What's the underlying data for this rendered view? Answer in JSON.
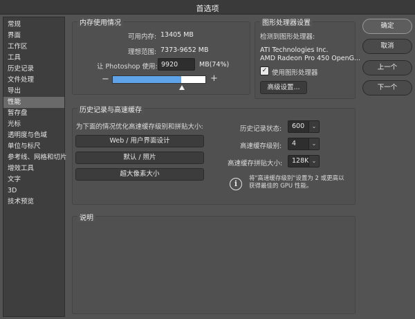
{
  "window": {
    "title": "首选项"
  },
  "sidebar": {
    "items": [
      {
        "label": "常规"
      },
      {
        "label": "界面"
      },
      {
        "label": "工作区"
      },
      {
        "label": "工具"
      },
      {
        "label": "历史记录"
      },
      {
        "label": "文件处理"
      },
      {
        "label": "导出"
      },
      {
        "label": "性能",
        "active": true
      },
      {
        "label": "暂存盘"
      },
      {
        "label": "光标"
      },
      {
        "label": "透明度与色域"
      },
      {
        "label": "单位与标尺"
      },
      {
        "label": "参考线、网格和切片"
      },
      {
        "label": "增效工具"
      },
      {
        "label": "文字"
      },
      {
        "label": "3D"
      },
      {
        "label": "技术预览"
      }
    ]
  },
  "memory": {
    "title": "内存使用情况",
    "available_label": "可用内存:",
    "available_value": "13405 MB",
    "ideal_label": "理想范围:",
    "ideal_value": "7373-9652 MB",
    "let_label": "让 Photoshop 使用:",
    "let_value": "9920",
    "let_unit": "MB(74%)",
    "minus": "−",
    "plus": "+",
    "usage_fraction": 0.74
  },
  "gpu": {
    "title": "图形处理器设置",
    "detected_label": "检测到图形处理器:",
    "vendor": "ATI Technologies Inc.",
    "model": "AMD Radeon Pro 450 OpenG...",
    "use_gpu_label": "使用图形处理器",
    "use_gpu_checked": true,
    "check_mark": "✓",
    "advanced_button": "高级设置..."
  },
  "history_cache": {
    "title": "历史记录与高速缓存",
    "optimize_label": "为下面的情况优化高速缓存级别和拼贴大小:",
    "btn_web": "Web / 用户界面设计",
    "btn_default": "默认 / 照片",
    "btn_huge": "超大像素大小",
    "history_states_label": "历史记录状态:",
    "history_states_value": "600",
    "cache_levels_label": "高速缓存级别:",
    "cache_levels_value": "4",
    "tile_size_label": "高速缓存拼贴大小:",
    "tile_size_value": "128K",
    "dropdown_arrow": "⌄",
    "info_glyph": "i",
    "info_text_line1": "将\"高速缓存级别\"设置为 2 或更高以",
    "info_text_line2": "获得最佳的 GPU 性能。"
  },
  "description": {
    "title": "说明"
  },
  "buttons": {
    "ok": "确定",
    "cancel": "取消",
    "prev": "上一个",
    "next": "下一个"
  }
}
